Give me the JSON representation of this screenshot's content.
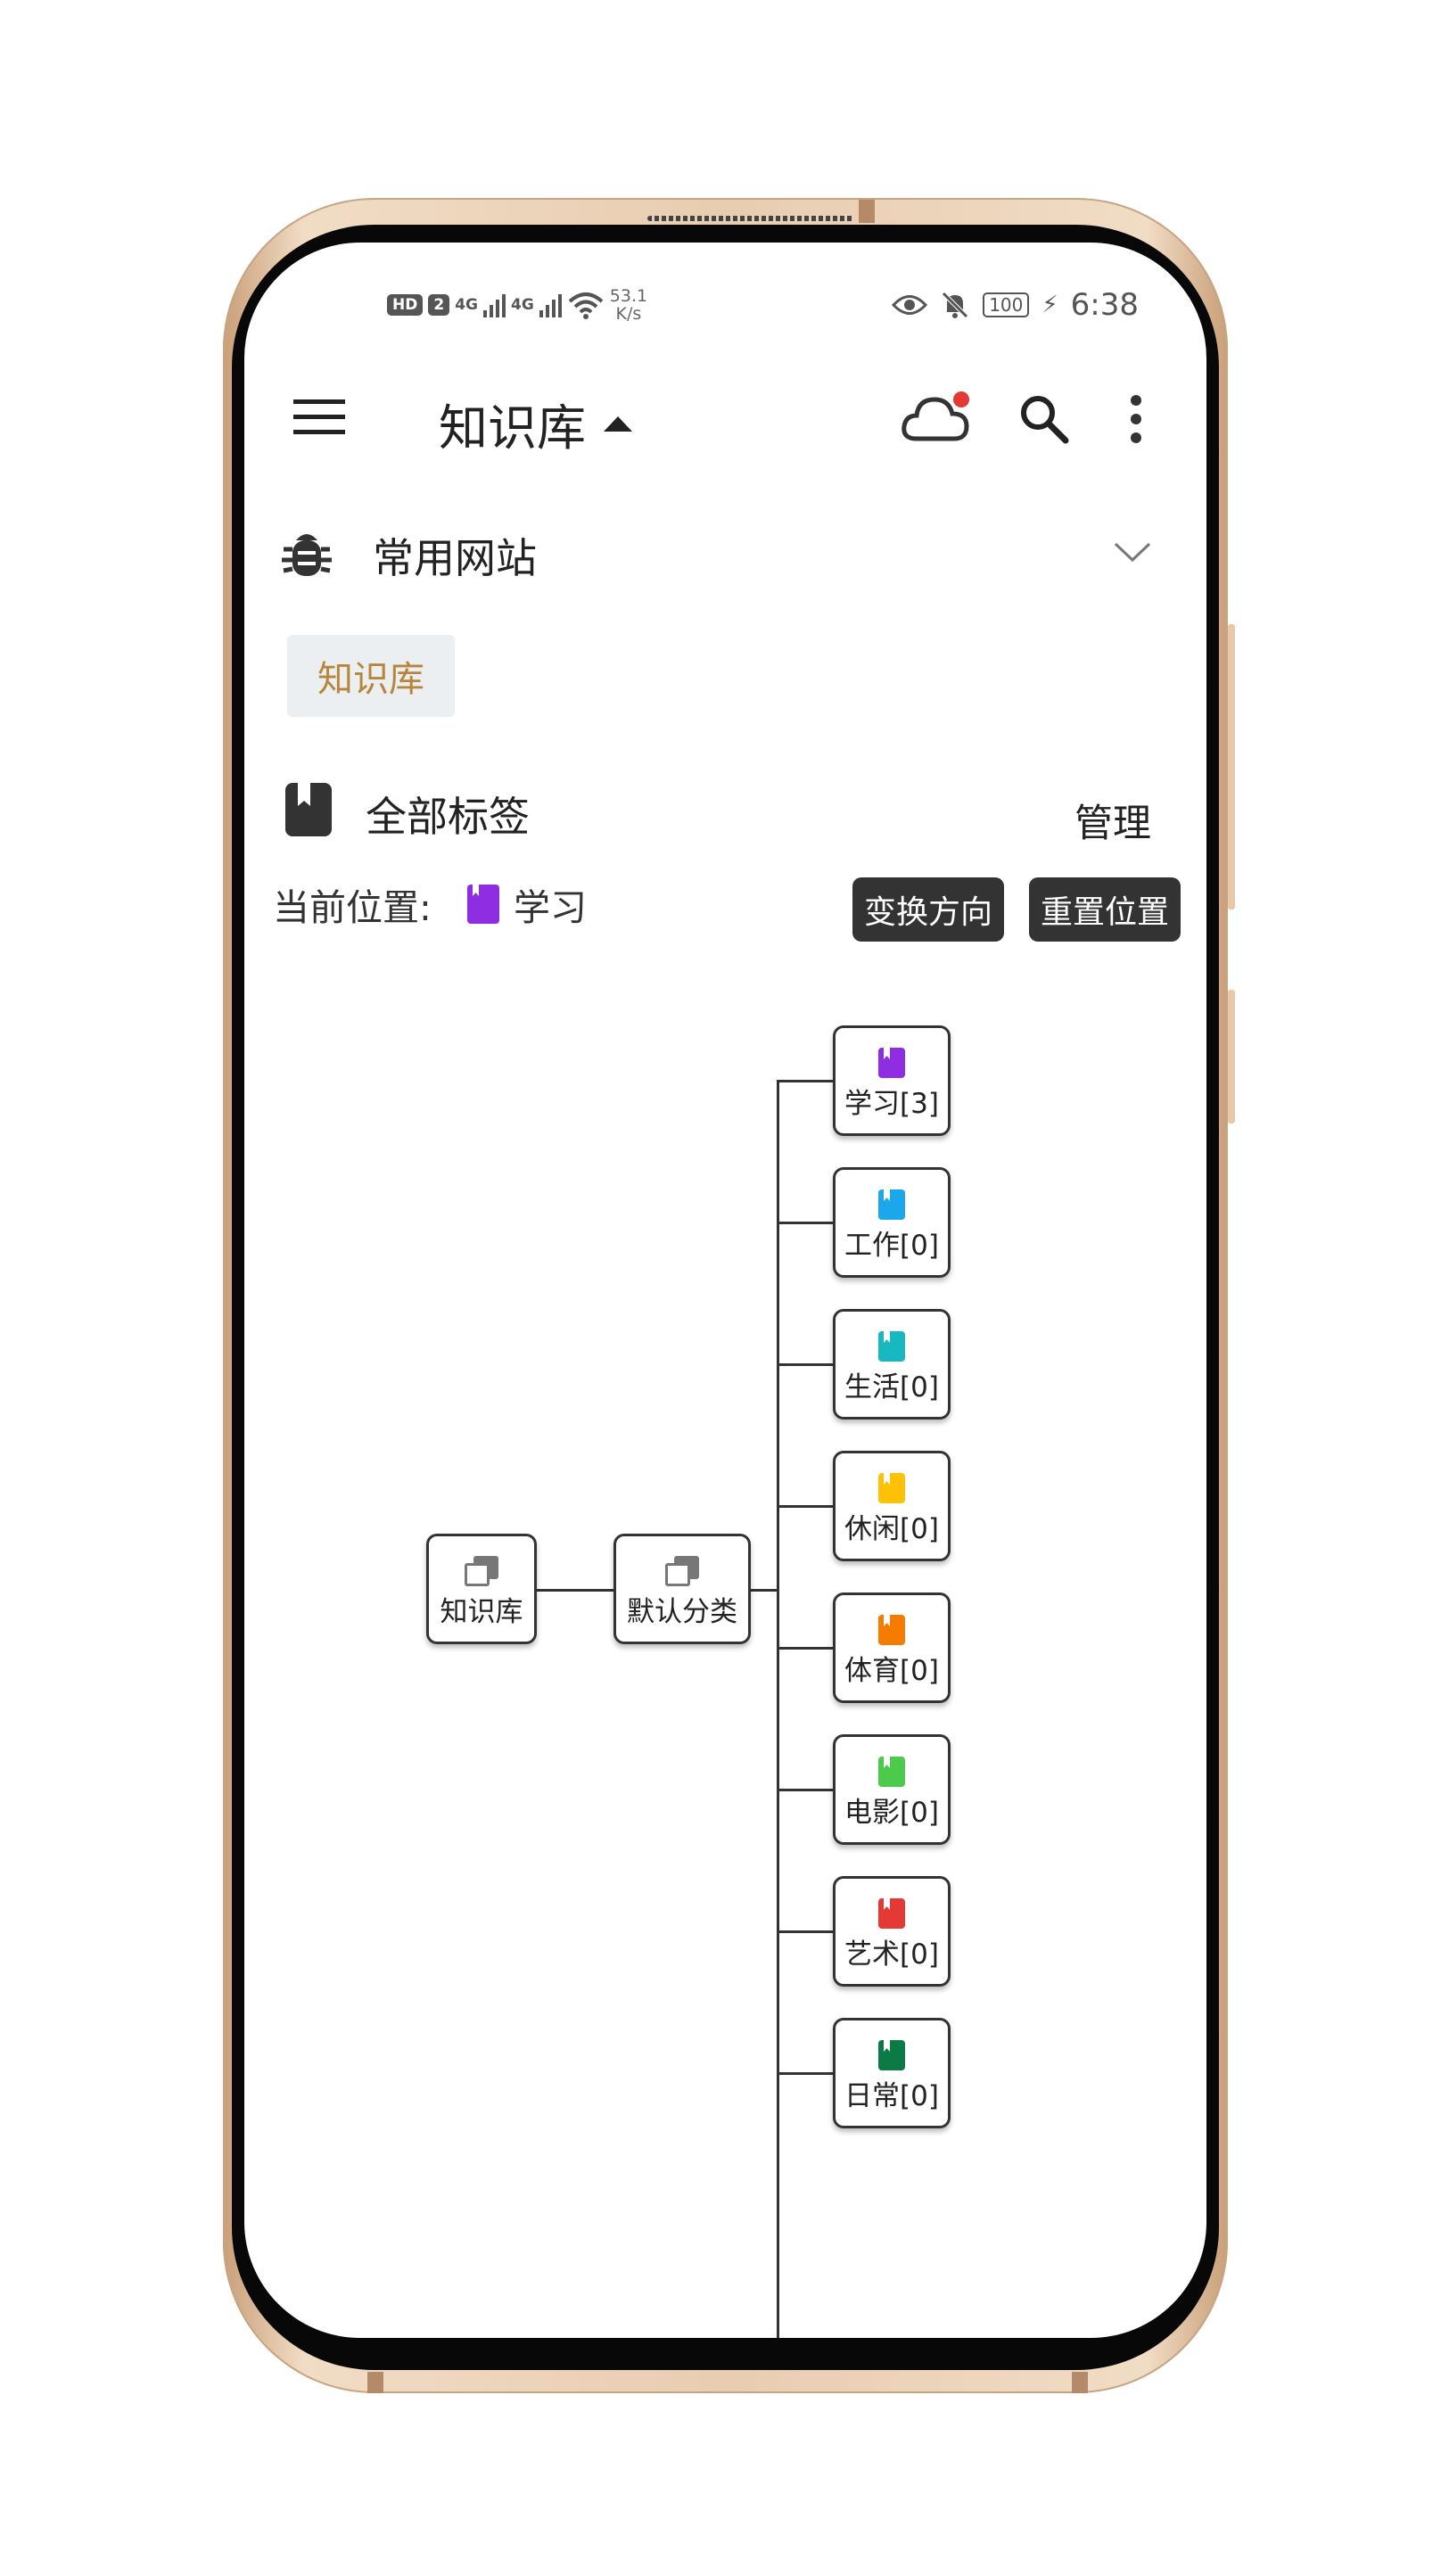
{
  "status_bar": {
    "hd": "HD",
    "sim": "2",
    "net1": "4G",
    "net2": "4G",
    "speed_top": "53.1",
    "speed_bottom": "K/s",
    "battery": "100",
    "time": "6:38"
  },
  "app_bar": {
    "title": "知识库",
    "sync_dot_color": "#e53935"
  },
  "websites_section": {
    "title": "常用网站",
    "chips": [
      "知识库"
    ]
  },
  "tags_section": {
    "title": "全部标签",
    "manage_label": "管理",
    "location_label": "当前位置:",
    "current_tag": "学习",
    "current_tag_color": "#8e2de2",
    "switch_direction_label": "变换方向",
    "reset_position_label": "重置位置"
  },
  "tree": {
    "root": {
      "label": "知识库",
      "icon": "library-icon"
    },
    "category": {
      "label": "默认分类",
      "icon": "library-icon"
    },
    "tags": [
      {
        "label": "学习[3]",
        "color": "#8e2de2"
      },
      {
        "label": "工作[0]",
        "color": "#1aa7ec"
      },
      {
        "label": "生活[0]",
        "color": "#17b8c0"
      },
      {
        "label": "休闲[0]",
        "color": "#ffc107"
      },
      {
        "label": "体育[0]",
        "color": "#f57c00"
      },
      {
        "label": "电影[0]",
        "color": "#4cca4c"
      },
      {
        "label": "艺术[0]",
        "color": "#e53935"
      },
      {
        "label": "日常[0]",
        "color": "#0b7a45"
      }
    ]
  }
}
